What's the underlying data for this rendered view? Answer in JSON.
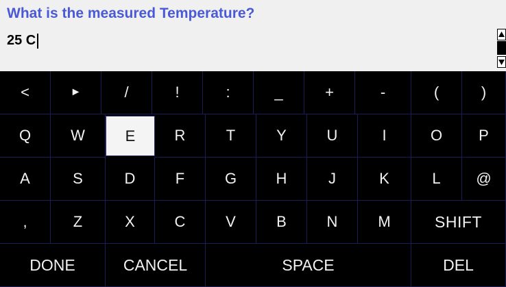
{
  "prompt": {
    "question": "What is the measured Temperature?",
    "answer_value": "25 C"
  },
  "keyboard": {
    "rows": [
      [
        "<",
        "►",
        "/",
        "!",
        ":",
        "_",
        "+",
        "-",
        "(",
        ")"
      ],
      [
        "Q",
        "W",
        "E",
        "R",
        "T",
        "Y",
        "U",
        "I",
        "O",
        "P"
      ],
      [
        "A",
        "S",
        "D",
        "F",
        "G",
        "H",
        "J",
        "K",
        "L",
        "@"
      ],
      [
        ",",
        "Z",
        "X",
        "C",
        "V",
        "B",
        "N",
        "M",
        "SHIFT"
      ],
      [
        "DONE",
        "CANCEL",
        "SPACE",
        "DEL"
      ]
    ],
    "selected_key": "E"
  },
  "colors": {
    "question_text": "#4a59d6",
    "key_text": "#f2f2f2",
    "keyboard_bg": "#000000",
    "key_border": "#1d1d55",
    "selected_key_bg": "#f4f4f4"
  },
  "icons": {
    "scroll_up": "scroll-up-arrow-icon",
    "scroll_down": "scroll-down-arrow-icon"
  }
}
